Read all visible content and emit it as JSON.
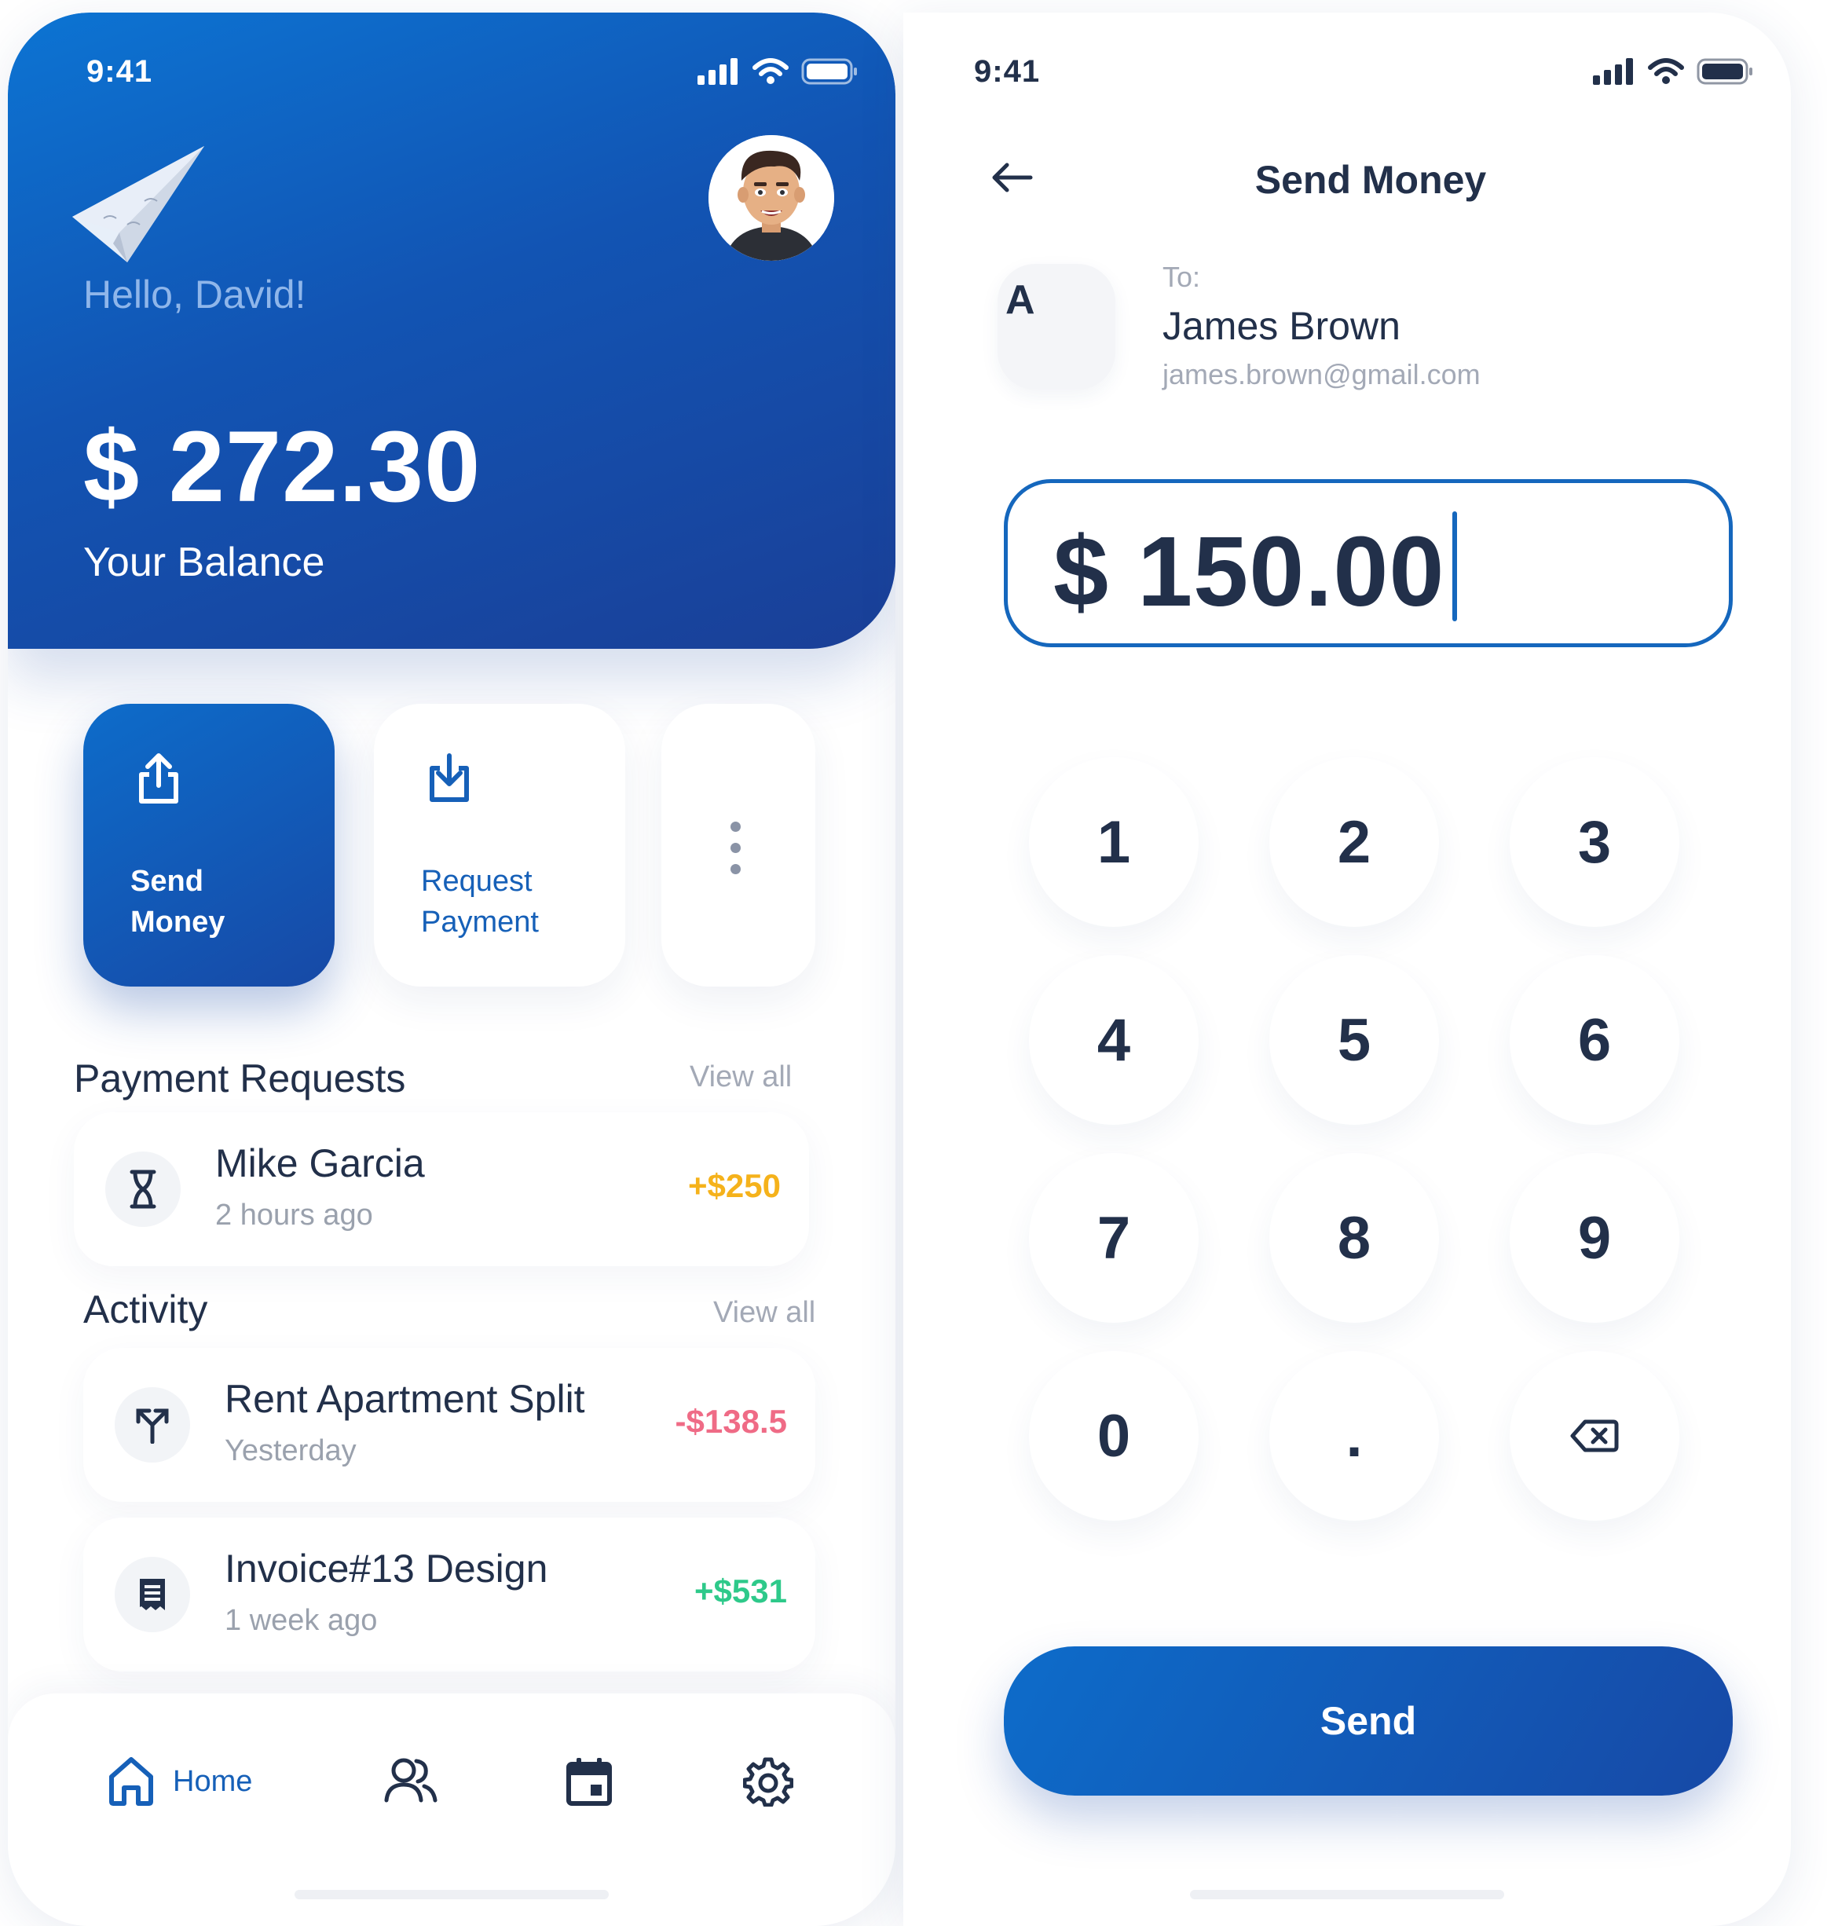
{
  "home": {
    "status_time": "9:41",
    "greeting": "Hello, David!",
    "balance": "$ 272.30",
    "balance_label": "Your Balance",
    "actions": {
      "send_label": "Send\nMoney",
      "request_label": "Request\nPayment"
    },
    "payment_requests": {
      "title": "Payment Requests",
      "view_all": "View all",
      "items": [
        {
          "name": "Mike Garcia",
          "time": "2 hours ago",
          "amount": "+$250",
          "icon": "hourglass-icon"
        }
      ]
    },
    "activity": {
      "title": "Activity",
      "view_all": "View all",
      "items": [
        {
          "name": "Rent Apartment Split",
          "time": "Yesterday",
          "amount": "-$138.5",
          "icon": "split-icon"
        },
        {
          "name": "Invoice#13 Design",
          "time": "1 week ago",
          "amount": "+$531",
          "icon": "receipt-icon"
        }
      ]
    },
    "bottom_nav": {
      "home_label": "Home",
      "items": [
        "home-icon",
        "users-icon",
        "calendar-icon",
        "settings-icon"
      ]
    }
  },
  "send": {
    "status_time": "9:41",
    "title": "Send Money",
    "to_label": "To:",
    "recipient_initial": "A",
    "recipient_name": "James Brown",
    "recipient_email": "james.brown@gmail.com",
    "amount": "$ 150.00",
    "keypad": [
      "1",
      "2",
      "3",
      "4",
      "5",
      "6",
      "7",
      "8",
      "9",
      "0",
      ".",
      "backspace"
    ],
    "send_label": "Send"
  },
  "colors": {
    "primary": "#1254b3",
    "accent_blue": "#1567bd",
    "text_dark": "#22304a",
    "muted": "#a3a9b6",
    "amount_orange": "#f5b21b",
    "amount_red": "#ef6b86",
    "amount_green": "#2ec98a"
  }
}
